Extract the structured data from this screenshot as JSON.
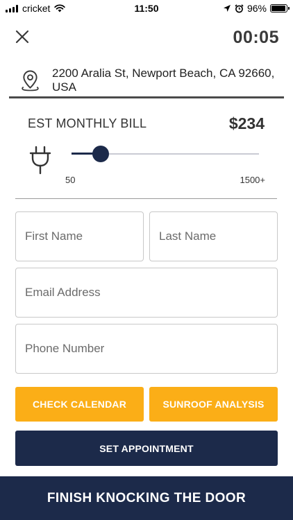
{
  "status_bar": {
    "carrier": "cricket",
    "time": "11:50",
    "battery": "96%",
    "battery_level": 0.96
  },
  "header": {
    "timer": "00:05"
  },
  "address": {
    "text": "2200 Aralia St, Newport Beach, CA 92660, USA"
  },
  "bill": {
    "label": "EST MONTHLY BILL",
    "value": "$234",
    "slider_min": "50",
    "slider_max": "1500+",
    "slider_fraction": 0.155
  },
  "form": {
    "first_name_placeholder": "First Name",
    "last_name_placeholder": "Last Name",
    "email_placeholder": "Email Address",
    "phone_placeholder": "Phone Number"
  },
  "buttons": {
    "check_calendar": "CHECK CALENDAR",
    "sunroof_analysis": "SUNROOF ANALYSIS",
    "set_appointment": "SET APPOINTMENT",
    "finish": "FINISH KNOCKING THE DOOR"
  },
  "colors": {
    "accent_yellow": "#fbae17",
    "navy": "#1c2a4a"
  }
}
